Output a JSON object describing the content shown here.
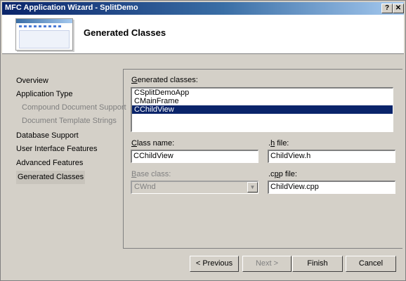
{
  "window": {
    "title": "MFC Application Wizard - SplitDemo",
    "help_button": "?",
    "close_button": "✕"
  },
  "header": {
    "title": "Generated Classes"
  },
  "nav": {
    "items": [
      {
        "label": "Overview"
      },
      {
        "label": "Application Type"
      },
      {
        "label": "Compound Document Support"
      },
      {
        "label": "Document Template Strings"
      },
      {
        "label": "Database Support"
      },
      {
        "label": "User Interface Features"
      },
      {
        "label": "Advanced Features"
      },
      {
        "label": "Generated Classes"
      }
    ]
  },
  "form": {
    "generated_classes_label_prefix": "",
    "generated_classes_label_u": "G",
    "generated_classes_label_rest": "enerated classes:",
    "classes": [
      "CSplitDemoApp",
      "CMainFrame",
      "CChildView"
    ],
    "selected_class": "CChildView",
    "class_name_label_u": "C",
    "class_name_label_rest": "lass name:",
    "class_name_value": "CChildView",
    "h_file_label_prefix": ".",
    "h_file_label_u": "h",
    "h_file_label_rest": " file:",
    "h_file_value": "ChildView.h",
    "base_class_label_u": "B",
    "base_class_label_rest": "ase class:",
    "base_class_value": "CWnd",
    "cpp_file_label_prefix": ".c",
    "cpp_file_label_u": "p",
    "cpp_file_label_rest": "p file:",
    "cpp_file_value": "ChildView.cpp"
  },
  "buttons": {
    "previous": "< Previous",
    "next": "Next >",
    "finish": "Finish",
    "cancel": "Cancel"
  }
}
